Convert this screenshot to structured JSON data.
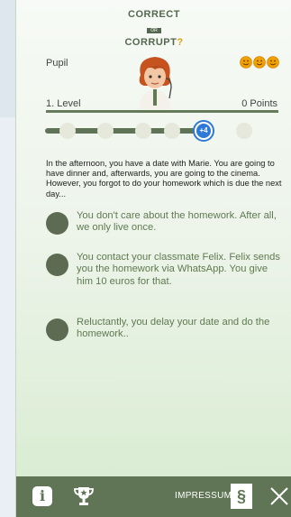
{
  "logo": {
    "line1": "CORRECT",
    "or": "OR",
    "line2": "CORRUPT",
    "mark": "?"
  },
  "header": {
    "role": "Pupil",
    "level": "1. Level",
    "points": "0 Points"
  },
  "progress": {
    "current_badge": "+4",
    "current_step": 5,
    "total_steps": 6
  },
  "story": "In the afternoon, you have a date with Marie. You are going to have dinner and, afterwards, you are going to the cinema. However, you forgot to do your homework which is due the next day...",
  "options": [
    {
      "text": "You don't care about the homework. After all, we only live once."
    },
    {
      "text": "You contact your classmate Felix. Felix sends you the homework via WhatsApp. You give him 10 euros for that."
    },
    {
      "text": "Reluctantly, you delay your date and do the homework.."
    }
  ],
  "footer": {
    "info_icon": "i",
    "impressum": "IMPRESSUM",
    "paragraph_icon": "§"
  },
  "colors": {
    "accent": "#5f7556",
    "badge": "#2f79d6",
    "option_text": "#5f7a50",
    "mood": "#f0a000"
  }
}
